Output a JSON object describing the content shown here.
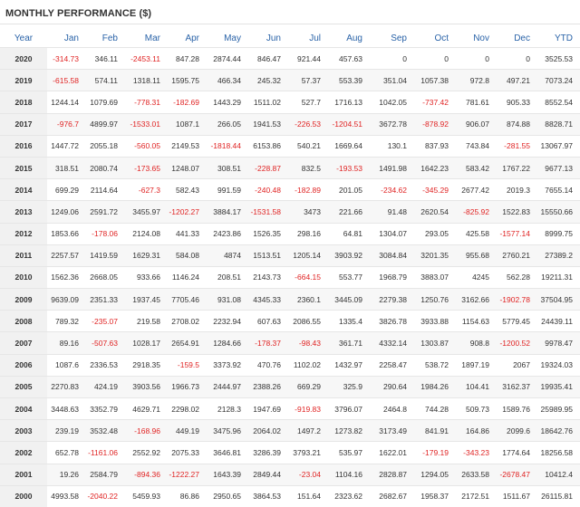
{
  "title": "MONTHLY PERFORMANCE ($)",
  "colors": {
    "header_text": "#2a63a8",
    "negative": "#e02424",
    "text": "#333333"
  },
  "columns": [
    "Year",
    "Jan",
    "Feb",
    "Mar",
    "Apr",
    "May",
    "Jun",
    "Jul",
    "Aug",
    "Sep",
    "Oct",
    "Nov",
    "Dec",
    "YTD"
  ],
  "rows": [
    [
      "2020",
      "-314.73",
      "346.11",
      "-2453.11",
      "847.28",
      "2874.44",
      "846.47",
      "921.44",
      "457.63",
      "0",
      "0",
      "0",
      "0",
      "3525.53"
    ],
    [
      "2019",
      "-615.58",
      "574.11",
      "1318.11",
      "1595.75",
      "466.34",
      "245.32",
      "57.37",
      "553.39",
      "351.04",
      "1057.38",
      "972.8",
      "497.21",
      "7073.24"
    ],
    [
      "2018",
      "1244.14",
      "1079.69",
      "-778.31",
      "-182.69",
      "1443.29",
      "1511.02",
      "527.7",
      "1716.13",
      "1042.05",
      "-737.42",
      "781.61",
      "905.33",
      "8552.54"
    ],
    [
      "2017",
      "-976.7",
      "4899.97",
      "-1533.01",
      "1087.1",
      "266.05",
      "1941.53",
      "-226.53",
      "-1204.51",
      "3672.78",
      "-878.92",
      "906.07",
      "874.88",
      "8828.71"
    ],
    [
      "2016",
      "1447.72",
      "2055.18",
      "-560.05",
      "2149.53",
      "-1818.44",
      "6153.86",
      "540.21",
      "1669.64",
      "130.1",
      "837.93",
      "743.84",
      "-281.55",
      "13067.97"
    ],
    [
      "2015",
      "318.51",
      "2080.74",
      "-173.65",
      "1248.07",
      "308.51",
      "-228.87",
      "832.5",
      "-193.53",
      "1491.98",
      "1642.23",
      "583.42",
      "1767.22",
      "9677.13"
    ],
    [
      "2014",
      "699.29",
      "2114.64",
      "-627.3",
      "582.43",
      "991.59",
      "-240.48",
      "-182.89",
      "201.05",
      "-234.62",
      "-345.29",
      "2677.42",
      "2019.3",
      "7655.14"
    ],
    [
      "2013",
      "1249.06",
      "2591.72",
      "3455.97",
      "-1202.27",
      "3884.17",
      "-1531.58",
      "3473",
      "221.66",
      "91.48",
      "2620.54",
      "-825.92",
      "1522.83",
      "15550.66"
    ],
    [
      "2012",
      "1853.66",
      "-178.06",
      "2124.08",
      "441.33",
      "2423.86",
      "1526.35",
      "298.16",
      "64.81",
      "1304.07",
      "293.05",
      "425.58",
      "-1577.14",
      "8999.75"
    ],
    [
      "2011",
      "2257.57",
      "1419.59",
      "1629.31",
      "584.08",
      "4874",
      "1513.51",
      "1205.14",
      "3903.92",
      "3084.84",
      "3201.35",
      "955.68",
      "2760.21",
      "27389.2"
    ],
    [
      "2010",
      "1562.36",
      "2668.05",
      "933.66",
      "1146.24",
      "208.51",
      "2143.73",
      "-664.15",
      "553.77",
      "1968.79",
      "3883.07",
      "4245",
      "562.28",
      "19211.31"
    ],
    [
      "2009",
      "9639.09",
      "2351.33",
      "1937.45",
      "7705.46",
      "931.08",
      "4345.33",
      "2360.1",
      "3445.09",
      "2279.38",
      "1250.76",
      "3162.66",
      "-1902.78",
      "37504.95"
    ],
    [
      "2008",
      "789.32",
      "-235.07",
      "219.58",
      "2708.02",
      "2232.94",
      "607.63",
      "2086.55",
      "1335.4",
      "3826.78",
      "3933.88",
      "1154.63",
      "5779.45",
      "24439.11"
    ],
    [
      "2007",
      "89.16",
      "-507.63",
      "1028.17",
      "2654.91",
      "1284.66",
      "-178.37",
      "-98.43",
      "361.71",
      "4332.14",
      "1303.87",
      "908.8",
      "-1200.52",
      "9978.47"
    ],
    [
      "2006",
      "1087.6",
      "2336.53",
      "2918.35",
      "-159.5",
      "3373.92",
      "470.76",
      "1102.02",
      "1432.97",
      "2258.47",
      "538.72",
      "1897.19",
      "2067",
      "19324.03"
    ],
    [
      "2005",
      "2270.83",
      "424.19",
      "3903.56",
      "1966.73",
      "2444.97",
      "2388.26",
      "669.29",
      "325.9",
      "290.64",
      "1984.26",
      "104.41",
      "3162.37",
      "19935.41"
    ],
    [
      "2004",
      "3448.63",
      "3352.79",
      "4629.71",
      "2298.02",
      "2128.3",
      "1947.69",
      "-919.83",
      "3796.07",
      "2464.8",
      "744.28",
      "509.73",
      "1589.76",
      "25989.95"
    ],
    [
      "2003",
      "239.19",
      "3532.48",
      "-168.96",
      "449.19",
      "3475.96",
      "2064.02",
      "1497.2",
      "1273.82",
      "3173.49",
      "841.91",
      "164.86",
      "2099.6",
      "18642.76"
    ],
    [
      "2002",
      "652.78",
      "-1161.06",
      "2552.92",
      "2075.33",
      "3646.81",
      "3286.39",
      "3793.21",
      "535.97",
      "1622.01",
      "-179.19",
      "-343.23",
      "1774.64",
      "18256.58"
    ],
    [
      "2001",
      "19.26",
      "2584.79",
      "-894.36",
      "-1222.27",
      "1643.39",
      "2849.44",
      "-23.04",
      "1104.16",
      "2828.87",
      "1294.05",
      "2633.58",
      "-2678.47",
      "10412.4"
    ],
    [
      "2000",
      "4993.58",
      "-2040.22",
      "5459.93",
      "86.86",
      "2950.65",
      "3864.53",
      "151.64",
      "2323.62",
      "2682.67",
      "1958.37",
      "2172.51",
      "1511.67",
      "26115.81"
    ]
  ]
}
